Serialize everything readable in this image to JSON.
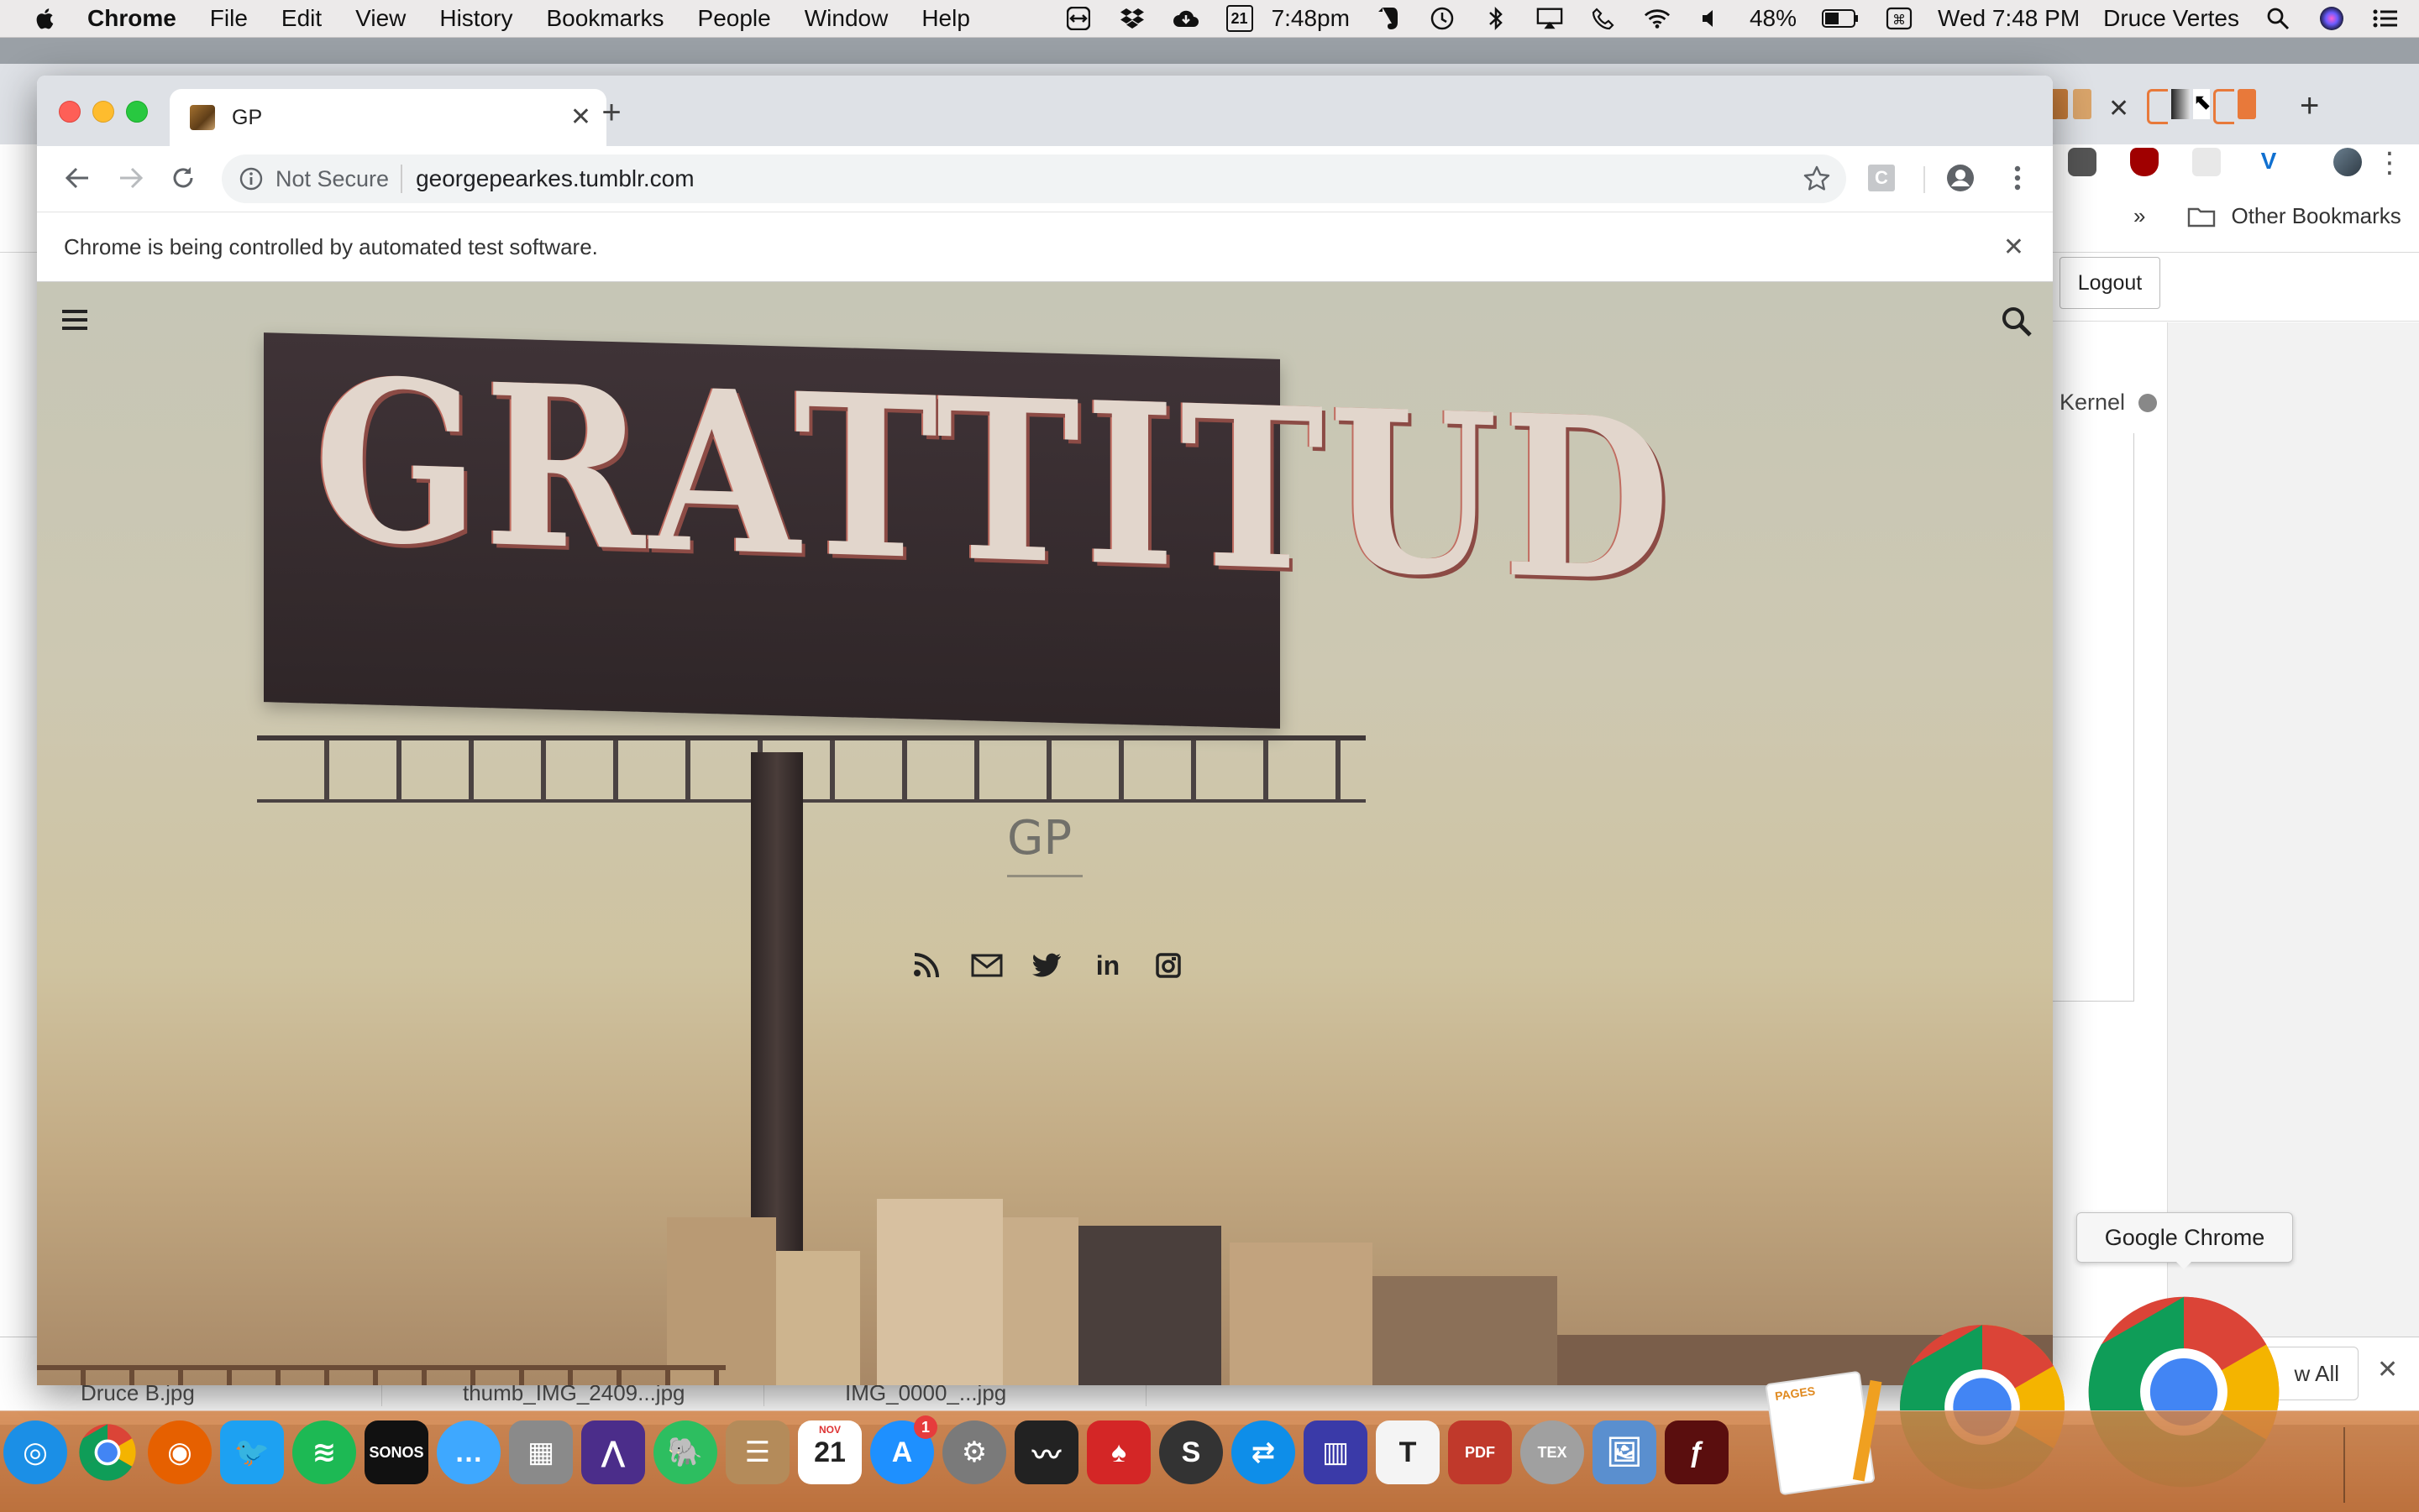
{
  "menubar": {
    "app_name": "Chrome",
    "menus": [
      "File",
      "Edit",
      "View",
      "History",
      "Bookmarks",
      "People",
      "Window",
      "Help"
    ],
    "calendar_day": "21",
    "time_short": "7:48pm",
    "battery": "48%",
    "clock": "Wed 7:48 PM",
    "user": "Druce Vertes",
    "icons": [
      "teamviewer-icon",
      "dropbox-icon",
      "cloud-icon",
      "calendar-icon",
      "evernote-icon",
      "time-machine-icon",
      "bluetooth-icon",
      "airplay-icon",
      "phone-icon",
      "wifi-icon",
      "volume-icon",
      "battery-icon",
      "input-menu-icon",
      "spotlight-icon",
      "siri-icon",
      "notification-center-icon"
    ]
  },
  "background_window": {
    "bookmarks_more": "»",
    "other_bookmarks": "Other Bookmarks",
    "logout_label": "Logout",
    "kernel_label": "Kernel",
    "downloads": [
      "Druce B.jpg",
      "thumb_IMG_2409...jpg",
      "IMG_0000_...jpg"
    ],
    "show_all_label": "w All"
  },
  "window": {
    "tab": {
      "title": "GP"
    },
    "omnibox": {
      "security_label": "Not Secure",
      "url": "georgepearkes.tumblr.com"
    },
    "extension_label": "C",
    "infobar_message": "Chrome is being controlled by automated test software."
  },
  "page": {
    "billboard_text": "GRATTITUD",
    "blog_title": "GP",
    "social_icons": [
      "rss-icon",
      "email-icon",
      "twitter-icon",
      "linkedin-icon",
      "instagram-icon"
    ],
    "linkedin_glyph": "in"
  },
  "tooltip": {
    "label": "Google Chrome"
  },
  "dock": {
    "apps": [
      {
        "name": "safari",
        "color": "#1b8fe6",
        "glyph": "◎"
      },
      {
        "name": "chrome",
        "color": "#ffffff",
        "glyph": ""
      },
      {
        "name": "firefox",
        "color": "#e66000",
        "glyph": "◉"
      },
      {
        "name": "twitter",
        "color": "#1da1f2",
        "glyph": "🐦"
      },
      {
        "name": "spotify",
        "color": "#1db954",
        "glyph": "≋"
      },
      {
        "name": "sonos",
        "color": "#111111",
        "glyph": "SONOS"
      },
      {
        "name": "messages",
        "color": "#3ea8ff",
        "glyph": "…"
      },
      {
        "name": "calculator",
        "color": "#8a8a8a",
        "glyph": "▦"
      },
      {
        "name": "affinity",
        "color": "#4b2d8a",
        "glyph": "⋀"
      },
      {
        "name": "evernote",
        "color": "#2dbe60",
        "glyph": "🐘"
      },
      {
        "name": "contacts",
        "color": "#b48b5a",
        "glyph": "☰"
      },
      {
        "name": "calendar",
        "color": "#ffffff",
        "glyph": "21",
        "sub": "NOV"
      },
      {
        "name": "app-store",
        "color": "#1e90ff",
        "glyph": "A",
        "badge": "1"
      },
      {
        "name": "system-preferences",
        "color": "#7a7a7a",
        "glyph": "⚙"
      },
      {
        "name": "activity-monitor",
        "color": "#222222",
        "glyph": "〰"
      },
      {
        "name": "pokerstars",
        "color": "#d42626",
        "glyph": "♠"
      },
      {
        "name": "s-app",
        "color": "#333333",
        "glyph": "S"
      },
      {
        "name": "teamviewer",
        "color": "#0e8ee9",
        "glyph": "⇄"
      },
      {
        "name": "mission-control",
        "color": "#3a3aa8",
        "glyph": "▥"
      },
      {
        "name": "typora",
        "color": "#f4f4f4",
        "glyph": "T"
      },
      {
        "name": "pdf-app",
        "color": "#c0392b",
        "glyph": "PDF"
      },
      {
        "name": "tex-shop",
        "color": "#a0a0a0",
        "glyph": "TEX"
      },
      {
        "name": "preview",
        "color": "#5a8fcf",
        "glyph": "🖼"
      },
      {
        "name": "flash",
        "color": "#5a0e0e",
        "glyph": "ƒ"
      }
    ],
    "pages_label": "PAGES"
  }
}
